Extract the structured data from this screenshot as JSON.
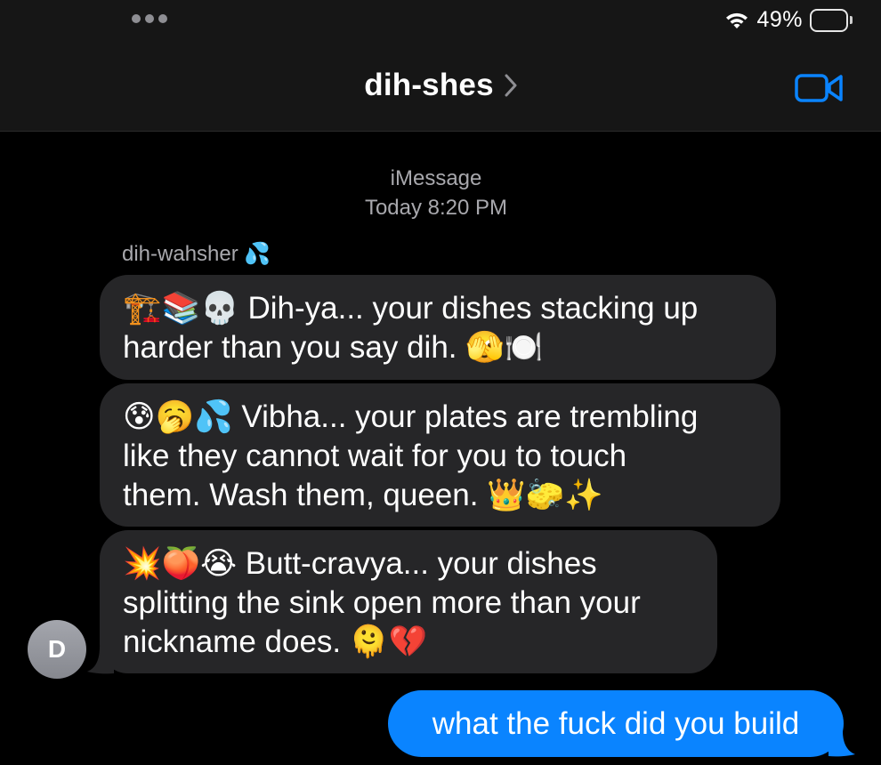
{
  "status_bar": {
    "battery_percent_label": "49%",
    "battery_level": 0.49
  },
  "header": {
    "title": "dih-shes"
  },
  "conversation": {
    "service": "iMessage",
    "timestamp": "Today 8:20 PM",
    "sender_name": "dih-wahsher 💦",
    "avatar_initial": "D",
    "incoming": [
      {
        "line1": "🏗️📚💀 Dih-ya... your dishes stacking up",
        "line2": "harder than you say dih. 🫣🍽️"
      },
      {
        "line1": "😰🥱💦 Vibha... your plates are trembling",
        "line2": "like they cannot wait for you to touch",
        "line3": "them. Wash them, queen. 👑🧽✨"
      },
      {
        "line1": "💥🍑😭 Butt-cravya... your dishes",
        "line2": "splitting the sink open more than your",
        "line3": "nickname does. 🫠💔"
      }
    ],
    "outgoing": [
      {
        "text": "what the fuck did you build"
      }
    ]
  },
  "colors": {
    "incoming_bubble": "#262628",
    "outgoing_bubble": "#0a84ff",
    "accent": "#0a84ff"
  },
  "icons": {
    "wifi": "wifi-icon",
    "battery": "battery-icon",
    "chevron": "chevron-right-icon",
    "video": "video-camera-icon"
  }
}
